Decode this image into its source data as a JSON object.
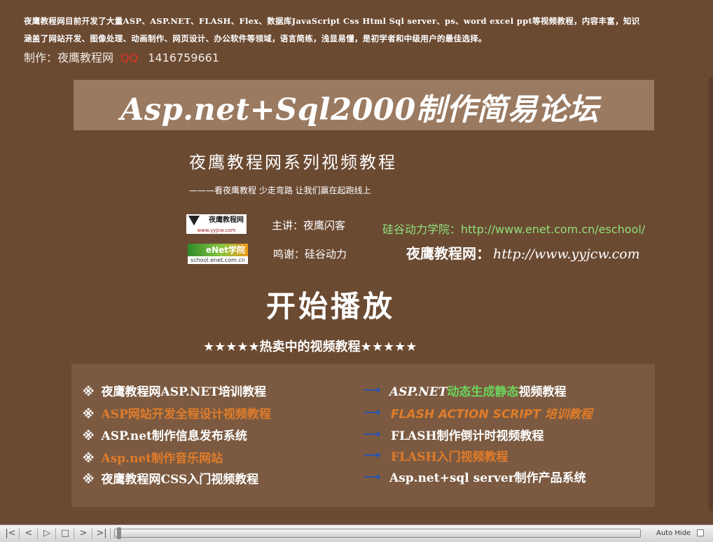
{
  "intro": {
    "line1": "夜鹰教程网目前开发了大量ASP、ASP.NET、FLASH、Flex、数据库JavaScript Css Html Sql server、ps、word excel ppt等视频教程，内容丰富，知识",
    "line2": "涵盖了网站开发、图像处理、动画制作、网页设计、办公软件等领域，语言简练，浅显易懂，是初学者和中级用户的最佳选择。"
  },
  "author": {
    "label": "制作：夜鹰教程网",
    "qq_label": "QQ",
    "qq_number": "1416759661"
  },
  "title": "Asp.net+Sql2000制作简易论坛",
  "subtitle": "夜鹰教程网系列视频教程",
  "slogan": "———看夜鹰教程 少走弯路 让我们赢在起跑线上",
  "logos": {
    "yyjcw_top": "夜鹰教程网",
    "yyjcw_url": "www.yyjcw.com",
    "enet_top": "eNet学院",
    "enet_url": "school.enet.com.cn"
  },
  "credits": {
    "lecturer": "主讲：夜鹰闪客",
    "thanks": "鸣谢：硅谷动力",
    "enet_site": "硅谷动力学院：http://www.enet.com.cn/eschool/",
    "yyjcw_site_label": "夜鹰教程网：",
    "yyjcw_site_url": "http://www.yyjcw.com"
  },
  "play_label": "开始播放",
  "hot_heading": "★★★★★热卖中的视频教程★★★★★",
  "left_items": [
    {
      "mark": "※",
      "text": "夜鹰教程网ASP.NET培训教程"
    },
    {
      "mark": "※",
      "text": "ASP网站开发全程设计视频教程"
    },
    {
      "mark": "※",
      "text": "ASP.net制作信息发布系统"
    },
    {
      "mark": "※",
      "text": "Asp.net制作音乐网站"
    },
    {
      "mark": "※",
      "text": "夜鹰教程网CSS入门视频教程"
    }
  ],
  "right_items": [
    {
      "part1": "ASP.NET",
      "part2": "动态生成静态",
      "part3": "视频教程"
    },
    {
      "text": "FLASH ACTION SCRIPT 培训教程"
    },
    {
      "text": "FLASH制作倒计时视频教程"
    },
    {
      "text": "FLASH入门视频教程"
    },
    {
      "text": "Asp.net+sql server制作产品系统"
    }
  ],
  "player": {
    "buttons": [
      "|<",
      "<",
      "▷",
      "□",
      ">",
      ">|"
    ],
    "progress": 0.0,
    "auto_hide_label": "Auto Hide"
  },
  "colors": {
    "background": "#6b4a32",
    "title_band": "#9a7a61",
    "panel": "#7b5a41",
    "highlight_orange": "#e07c2a",
    "highlight_green": "#6bd45b",
    "qq_red": "#e0321e",
    "arrow_blue": "#2d53b0"
  }
}
